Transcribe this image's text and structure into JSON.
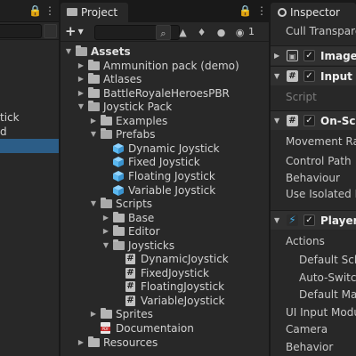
{
  "hierarchy": {
    "items": [
      {
        "label": "tick",
        "selected": false
      },
      {
        "label": "d",
        "selected": false
      },
      {
        "label": "",
        "selected": true
      }
    ]
  },
  "project": {
    "tab_label": "Project",
    "hidden_count": "1",
    "tree": [
      {
        "label": "Assets",
        "depth": 0,
        "type": "folder",
        "expanded": true,
        "bold": true
      },
      {
        "label": "Ammunition pack (demo)",
        "depth": 1,
        "type": "folder",
        "expanded": false
      },
      {
        "label": "Atlases",
        "depth": 1,
        "type": "folder",
        "expanded": false
      },
      {
        "label": "BattleRoyaleHeroesPBR",
        "depth": 1,
        "type": "folder",
        "expanded": false
      },
      {
        "label": "Joystick Pack",
        "depth": 1,
        "type": "folder",
        "expanded": true
      },
      {
        "label": "Examples",
        "depth": 2,
        "type": "folder",
        "expanded": false
      },
      {
        "label": "Prefabs",
        "depth": 2,
        "type": "folder",
        "expanded": true
      },
      {
        "label": "Dynamic Joystick",
        "depth": 3,
        "type": "prefab"
      },
      {
        "label": "Fixed Joystick",
        "depth": 3,
        "type": "prefab"
      },
      {
        "label": "Floating Joystick",
        "depth": 3,
        "type": "prefab"
      },
      {
        "label": "Variable Joystick",
        "depth": 3,
        "type": "prefab"
      },
      {
        "label": "Scripts",
        "depth": 2,
        "type": "folder",
        "expanded": true
      },
      {
        "label": "Base",
        "depth": 3,
        "type": "folder",
        "expanded": false
      },
      {
        "label": "Editor",
        "depth": 3,
        "type": "folder",
        "expanded": false
      },
      {
        "label": "Joysticks",
        "depth": 3,
        "type": "folder",
        "expanded": true
      },
      {
        "label": "DynamicJoystick",
        "depth": 4,
        "type": "script"
      },
      {
        "label": "FixedJoystick",
        "depth": 4,
        "type": "script"
      },
      {
        "label": "FloatingJoystick",
        "depth": 4,
        "type": "script"
      },
      {
        "label": "VariableJoystick",
        "depth": 4,
        "type": "script"
      },
      {
        "label": "Sprites",
        "depth": 2,
        "type": "folder",
        "expanded": false
      },
      {
        "label": "Documentaion",
        "depth": 2,
        "type": "pdf"
      },
      {
        "label": "Resources",
        "depth": 1,
        "type": "folder",
        "expanded": false
      }
    ]
  },
  "inspector": {
    "tab_label": "Inspector",
    "cull_label": "Cull Transparen",
    "components": {
      "image": "Image",
      "input_module": "Input M",
      "script_label": "Script",
      "on_screen": "On-Sc",
      "player": "Player"
    },
    "on_screen_fields": [
      "Movement Ra",
      "Control Path",
      "Behaviour",
      "Use Isolated In"
    ],
    "player_fields": [
      {
        "label": "Actions",
        "indent": false
      },
      {
        "label": "Default Sch",
        "indent": true
      },
      {
        "label": "Auto-Switc",
        "indent": true
      },
      {
        "label": "Default Map",
        "indent": true
      },
      {
        "label": "UI Input Modu",
        "indent": false
      },
      {
        "label": "Camera",
        "indent": false
      },
      {
        "label": "Behavior",
        "indent": false
      }
    ]
  },
  "colors": {
    "selection": "#2c5d87",
    "prefab": "#5bb8f0",
    "script_icon": "#c2c2c2",
    "player_icon": "#3fa6e0"
  }
}
